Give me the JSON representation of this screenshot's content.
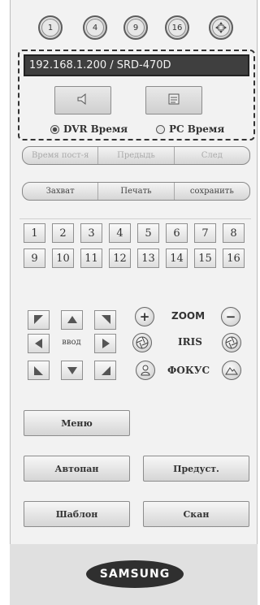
{
  "channels": [
    "1",
    "4",
    "9",
    "16"
  ],
  "address": "192.168.1.200   / SRD-470D",
  "time_source": {
    "dvr_label": "DVR Время",
    "pc_label": "PC Время",
    "selected": "dvr"
  },
  "playback_bar": [
    "Время пост-я",
    "Предыдь",
    "След"
  ],
  "action_bar": [
    "Захват",
    "Печать",
    "сохранить"
  ],
  "cameras": [
    "1",
    "2",
    "3",
    "4",
    "5",
    "6",
    "7",
    "8",
    "9",
    "10",
    "11",
    "12",
    "13",
    "14",
    "15",
    "16"
  ],
  "ptz": {
    "center_label": "ввод",
    "zoom_label": "ZOOM",
    "iris_label": "IRIS",
    "focus_label": "ФОКУС"
  },
  "buttons": {
    "menu": "Меню",
    "autopan": "Автопан",
    "preset": "Предуст.",
    "pattern": "Шаблон",
    "scan": "Скан"
  },
  "brand": "SAMSUNG"
}
